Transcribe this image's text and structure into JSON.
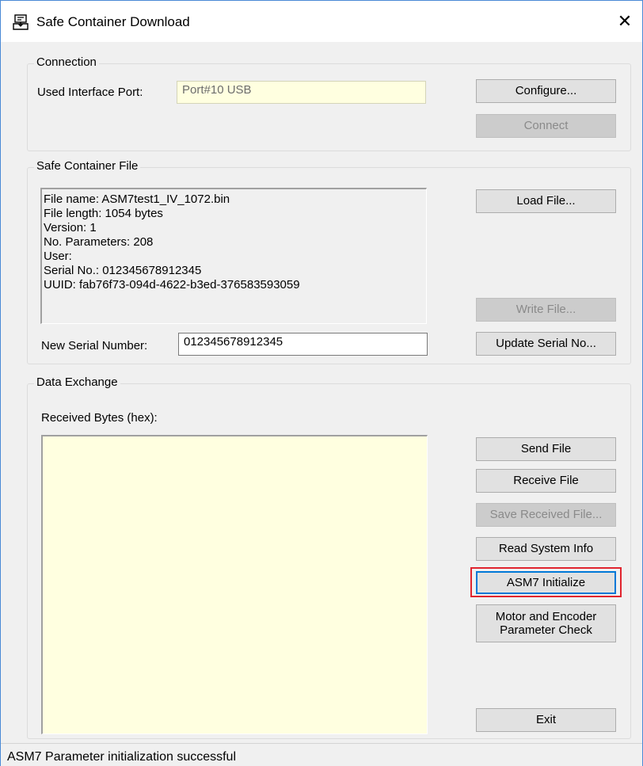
{
  "window": {
    "title": "Safe Container Download",
    "close_glyph": "✕",
    "title_icon": "download-container-icon"
  },
  "connection": {
    "group_title": "Connection",
    "port_label": "Used Interface Port:",
    "port_value": "Port#10  USB",
    "configure_label": "Configure...",
    "connect_label": "Connect"
  },
  "file": {
    "group_title": "Safe Container File",
    "info_lines": [
      "File name: ASM7test1_IV_1072.bin",
      "File length: 1054 bytes",
      "Version: 1",
      "No. Parameters: 208",
      "User:",
      "Serial No.: 012345678912345",
      "UUID: fab76f73-094d-4622-b3ed-376583593059"
    ],
    "load_label": "Load File...",
    "write_label": "Write File...",
    "serial_label": "New Serial Number:",
    "serial_value": "012345678912345",
    "update_label": "Update Serial No..."
  },
  "exchange": {
    "group_title": "Data Exchange",
    "received_label": "Received Bytes (hex):",
    "received_value": "",
    "send_label": "Send File",
    "receive_label": "Receive File",
    "save_label": "Save Received File...",
    "read_info_label": "Read System Info",
    "asm7_init_label": "ASM7 Initialize",
    "motor_check_label": "Motor and Encoder Parameter Check",
    "exit_label": "Exit"
  },
  "status": {
    "text": "ASM7 Parameter initialization successful"
  },
  "colors": {
    "readonly_bg": "#ffffe0",
    "focus_border": "#0078d7",
    "highlight": "#e0242e",
    "window_border": "#4a8ad6"
  }
}
